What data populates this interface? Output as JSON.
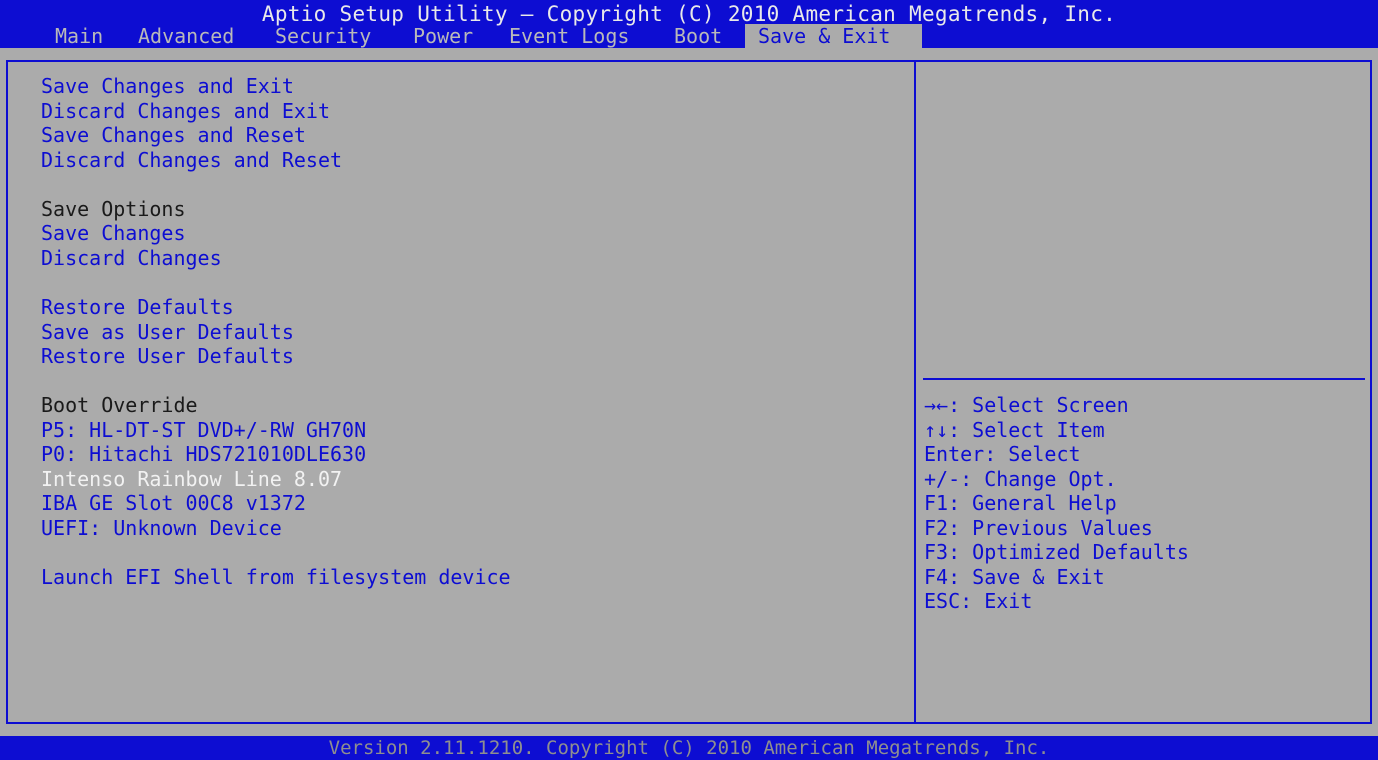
{
  "title": "Aptio Setup Utility – Copyright (C) 2010 American Megatrends, Inc.",
  "tabs": [
    {
      "label": "Main"
    },
    {
      "label": "Advanced"
    },
    {
      "label": "Security"
    },
    {
      "label": "Power"
    },
    {
      "label": "Event Logs"
    },
    {
      "label": "Boot"
    },
    {
      "label": "Save & Exit",
      "active": true
    }
  ],
  "menu": {
    "save_changes_and_exit": "Save Changes and Exit",
    "discard_changes_and_exit": "Discard Changes and Exit",
    "save_changes_and_reset": "Save Changes and Reset",
    "discard_changes_and_reset": "Discard Changes and Reset",
    "save_options_header": "Save Options",
    "save_changes": "Save Changes",
    "discard_changes": "Discard Changes",
    "restore_defaults": "Restore Defaults",
    "save_as_user_defaults": "Save as User Defaults",
    "restore_user_defaults": "Restore User Defaults",
    "boot_override_header": "Boot Override",
    "boot_devices": [
      "P5: HL-DT-ST DVD+/-RW GH70N",
      "P0: Hitachi HDS721010DLE630",
      "Intenso Rainbow Line 8.07",
      "IBA GE Slot 00C8 v1372",
      "UEFI: Unknown Device"
    ],
    "selected_item": "Intenso Rainbow Line 8.07",
    "launch_efi_shell": "Launch EFI Shell from filesystem device"
  },
  "help": [
    "→←: Select Screen",
    "↑↓: Select Item",
    "Enter: Select",
    "+/-: Change Opt.",
    "F1: General Help",
    "F2: Previous Values",
    "F3: Optimized Defaults",
    "F4: Save & Exit",
    "ESC: Exit"
  ],
  "footer": "Version 2.11.1210. Copyright (C) 2010 American Megatrends, Inc.",
  "colors": {
    "accent_blue": "#0d0dd2",
    "background_gray": "#ababab",
    "selected_text": "#f2f2f2",
    "header_text": "#1a1a1a"
  }
}
